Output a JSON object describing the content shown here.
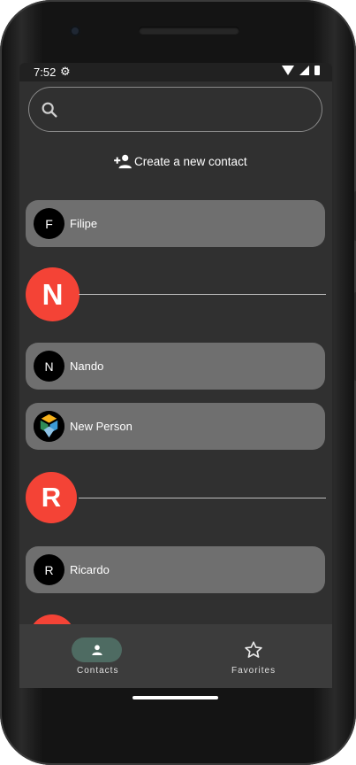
{
  "status_bar": {
    "time": "7:52",
    "icons": [
      "gear-icon",
      "wifi-icon",
      "signal-icon",
      "battery-icon"
    ]
  },
  "search": {
    "placeholder": "",
    "value": ""
  },
  "create_contact": {
    "label": "Create a new contact",
    "icon": "person-add-icon"
  },
  "contacts": [
    {
      "initial": "F",
      "name": "Filipe"
    },
    {
      "initial": "N",
      "name": "Nando"
    },
    {
      "initial": "",
      "name": "New Person",
      "avatar": "colorful-logo"
    },
    {
      "initial": "R",
      "name": "Ricardo"
    }
  ],
  "section_letters": [
    "N",
    "R"
  ],
  "bottom_nav": {
    "items": [
      {
        "label": "Contacts",
        "icon": "person-icon",
        "active": true
      },
      {
        "label": "Favorites",
        "icon": "star-outline-icon",
        "active": false
      }
    ]
  },
  "colors": {
    "screen_bg": "#303030",
    "contact_card": "#6f6f6f",
    "section_accent": "#f44336",
    "nav_active_pill": "#4e6b62"
  }
}
